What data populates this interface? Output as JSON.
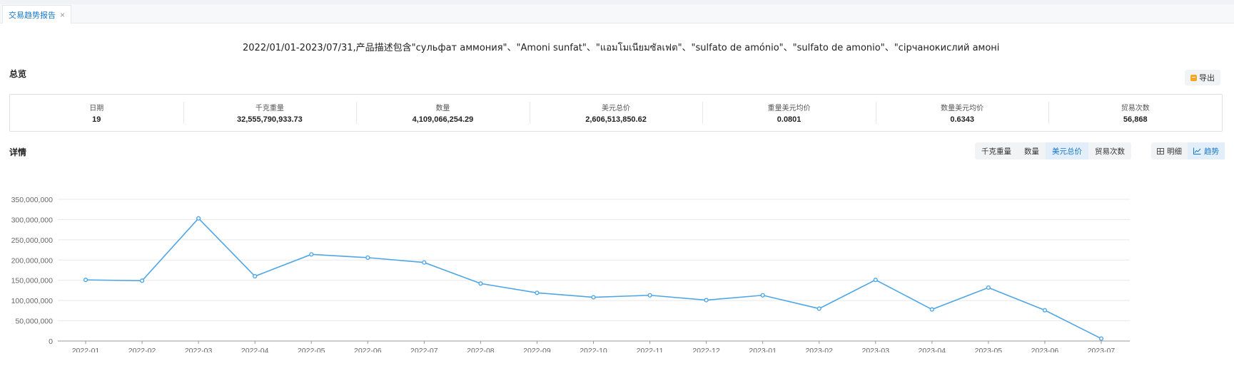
{
  "tab": {
    "label": "交易趋势报告",
    "close_glyph": "×"
  },
  "report_title": "2022/01/01-2023/07/31,产品描述包含\"сульфат аммония\"、\"Amoni sunfat\"、\"แอมโมเนียมซัลเฟต\"、\"sulfato de amónio\"、\"sulfato de amonio\"、\"сірчанокислий амоній\"、\"ammonium s...",
  "overview": {
    "label": "总览",
    "export_label": "导出",
    "stats": [
      {
        "label": "日期",
        "value": "19"
      },
      {
        "label": "千克重量",
        "value": "32,555,790,933.73"
      },
      {
        "label": "数量",
        "value": "4,109,066,254.29"
      },
      {
        "label": "美元总价",
        "value": "2,606,513,850.62"
      },
      {
        "label": "重量美元均价",
        "value": "0.0801"
      },
      {
        "label": "数量美元均价",
        "value": "0.6343"
      },
      {
        "label": "贸易次数",
        "value": "56,868"
      }
    ]
  },
  "details": {
    "label": "详情",
    "metric_tabs": [
      {
        "label": "千克重量",
        "active": false
      },
      {
        "label": "数量",
        "active": false
      },
      {
        "label": "美元总价",
        "active": true
      },
      {
        "label": "贸易次数",
        "active": false
      }
    ],
    "view_tabs": [
      {
        "label": "明细",
        "icon": "table-icon",
        "active": false
      },
      {
        "label": "趋势",
        "icon": "trend-icon",
        "active": true
      }
    ]
  },
  "colors": {
    "accent": "#1677c9",
    "line": "#4fa6e6",
    "grid": "#e8e8e8"
  },
  "chart_data": {
    "type": "line",
    "categories": [
      "2022-01",
      "2022-02",
      "2022-03",
      "2022-04",
      "2022-05",
      "2022-06",
      "2022-07",
      "2022-08",
      "2022-09",
      "2022-10",
      "2022-11",
      "2022-12",
      "2023-01",
      "2023-02",
      "2023-03",
      "2023-04",
      "2023-05",
      "2023-06",
      "2023-07"
    ],
    "y_ticks": [
      0,
      50000000,
      100000000,
      150000000,
      200000000,
      250000000,
      300000000,
      350000000
    ],
    "y_tick_labels": [
      "0",
      "50,000,000",
      "100,000,000",
      "150,000,000",
      "200,000,000",
      "250,000,000",
      "300,000,000",
      "350,000,000"
    ],
    "ylim": [
      0,
      350000000
    ],
    "grid": true,
    "series": [
      {
        "values": [
          151000000,
          149000000,
          303000000,
          160000000,
          214000000,
          206000000,
          194000000,
          142000000,
          119000000,
          108000000,
          113000000,
          101000000,
          113000000,
          80000000,
          151000000,
          78000000,
          132000000,
          76000000,
          6000000
        ]
      }
    ]
  }
}
